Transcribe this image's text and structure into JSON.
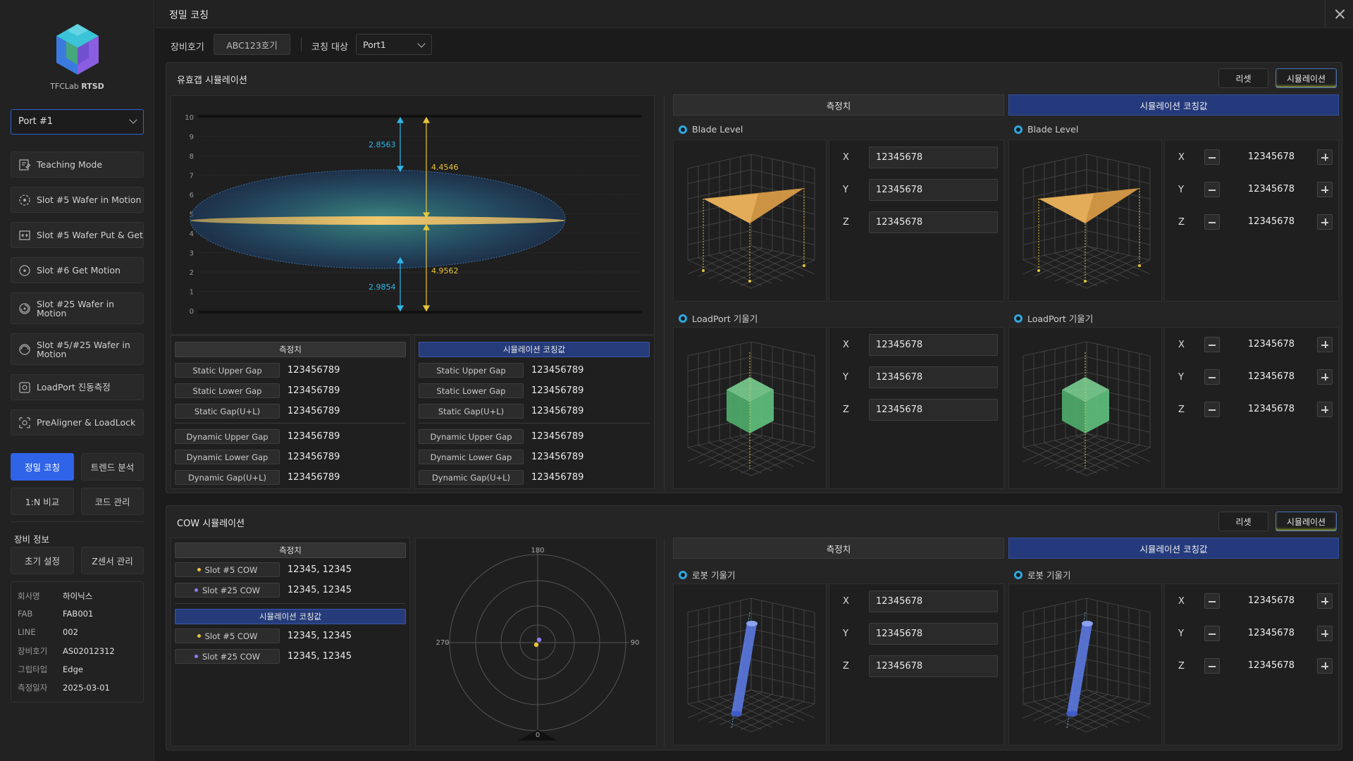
{
  "app": {
    "brand_prefix": "TFCLab",
    "brand_name": "RTSD",
    "page_title": "정밀 코칭"
  },
  "sidebar": {
    "port_select": "Port #1",
    "menu": [
      {
        "label": "Teaching Mode",
        "icon": "teaching-icon"
      },
      {
        "label": "Slot #5 Wafer in Motion",
        "icon": "motion-icon"
      },
      {
        "label": "Slot #5 Wafer Put & Get",
        "icon": "put-get-icon"
      },
      {
        "label": "Slot #6 Get Motion",
        "icon": "get-motion-icon"
      },
      {
        "label": "Slot #25 Wafer in Motion",
        "icon": "wafer-motion-icon"
      },
      {
        "label": "Slot #5/#25 Wafer in Motion",
        "icon": "wafer-motion-icon"
      },
      {
        "label": "LoadPort 진동측정",
        "icon": "vibration-icon"
      },
      {
        "label": "PreAligner & LoadLock",
        "icon": "prealigner-icon"
      }
    ],
    "buttons": {
      "precision": "정밀 코칭",
      "trend": "트렌드 분석",
      "compare": "1:N 비교",
      "code": "코드 관리",
      "init": "초기 설정",
      "zsensor": "Z센서 관리"
    },
    "info_title": "장비 정보",
    "info": [
      {
        "k": "회사명",
        "v": "하이닉스"
      },
      {
        "k": "FAB",
        "v": "FAB001"
      },
      {
        "k": "LINE",
        "v": "002"
      },
      {
        "k": "장비호기",
        "v": "AS02012312"
      },
      {
        "k": "그립타입",
        "v": "Edge"
      },
      {
        "k": "측정일자",
        "v": "2025-03-01"
      }
    ]
  },
  "filters": {
    "equip_label": "장비호기",
    "equip_value": "ABC123호기",
    "target_label": "코칭 대상",
    "target_value": "Port1"
  },
  "gap_panel": {
    "title": "유효갭 시뮬레이션",
    "reset": "리셋",
    "simulate": "시뮬레이션",
    "chart": {
      "y_ticks": [
        "0",
        "1",
        "2",
        "3",
        "4",
        "5",
        "6",
        "7",
        "8",
        "9",
        "10"
      ],
      "dims": {
        "upper_small": "2.8563",
        "upper_big": "4.4546",
        "lower_big": "4.9562",
        "lower_small": "2.9854"
      }
    },
    "measure_head": "측정치",
    "sim_head": "시뮬레이션 코칭값",
    "measure_rows": [
      {
        "label": "Static Upper Gap",
        "value": "123456789"
      },
      {
        "label": "Static Lower Gap",
        "value": "123456789"
      },
      {
        "label": "Static Gap(U+L)",
        "value": "123456789"
      },
      {
        "label": "Dynamic Upper Gap",
        "value": "123456789"
      },
      {
        "label": "Dynamic Lower Gap",
        "value": "123456789"
      },
      {
        "label": "Dynamic Gap(U+L)",
        "value": "123456789"
      }
    ],
    "sim_rows": [
      {
        "label": "Static Upper Gap",
        "value": "123456789"
      },
      {
        "label": "Static Lower Gap",
        "value": "123456789"
      },
      {
        "label": "Static Gap(U+L)",
        "value": "123456789"
      },
      {
        "label": "Dynamic Upper Gap",
        "value": "123456789"
      },
      {
        "label": "Dynamic Lower Gap",
        "value": "123456789"
      },
      {
        "label": "Dynamic Gap(U+L)",
        "value": "123456789"
      }
    ],
    "col_measure": "측정치",
    "col_sim": "시뮬레이션 코칭값",
    "blade_label": "Blade Level",
    "loadport_label": "LoadPort 기울기",
    "blade_measure": {
      "x": "12345678",
      "y": "12345678",
      "z": "12345678"
    },
    "blade_sim": {
      "x": "12345678",
      "y": "12345678",
      "z": "12345678"
    },
    "lp_measure": {
      "x": "12345678",
      "y": "12345678",
      "z": "12345678"
    },
    "lp_sim": {
      "x": "12345678",
      "y": "12345678",
      "z": "12345678"
    }
  },
  "cow_panel": {
    "title": "COW 시뮬레이션",
    "reset": "리셋",
    "simulate": "시뮬레이션",
    "measure_head": "측정치",
    "sim_head": "시뮬레이션 코칭값",
    "measure_rows": [
      {
        "label": "Slot #5 COW",
        "value": "12345, 12345",
        "color": "#e8c53a"
      },
      {
        "label": "Slot #25 COW",
        "value": "12345, 12345",
        "color": "#8b7cf0"
      }
    ],
    "sim_rows": [
      {
        "label": "Slot #5 COW",
        "value": "12345, 12345",
        "color": "#e8c53a"
      },
      {
        "label": "Slot #25 COW",
        "value": "12345, 12345",
        "color": "#8b7cf0"
      }
    ],
    "polar": {
      "top": "180",
      "right": "90",
      "bottom": "0",
      "left": "270"
    },
    "col_measure": "측정치",
    "col_sim": "시뮬레이션 코칭값",
    "robot_label": "로봇 기울기",
    "robot_measure": {
      "x": "12345678",
      "y": "12345678",
      "z": "12345678"
    },
    "robot_sim": {
      "x": "12345678",
      "y": "12345678",
      "z": "12345678"
    }
  },
  "axes": {
    "x": "X",
    "y": "Y",
    "z": "Z"
  },
  "colors": {
    "accent": "#2f63e8",
    "cyan": "#2ea7e0",
    "gold": "#e8c53a",
    "blade": "#e0a048",
    "box": "#5fc27d",
    "robot": "#5b78e0"
  }
}
